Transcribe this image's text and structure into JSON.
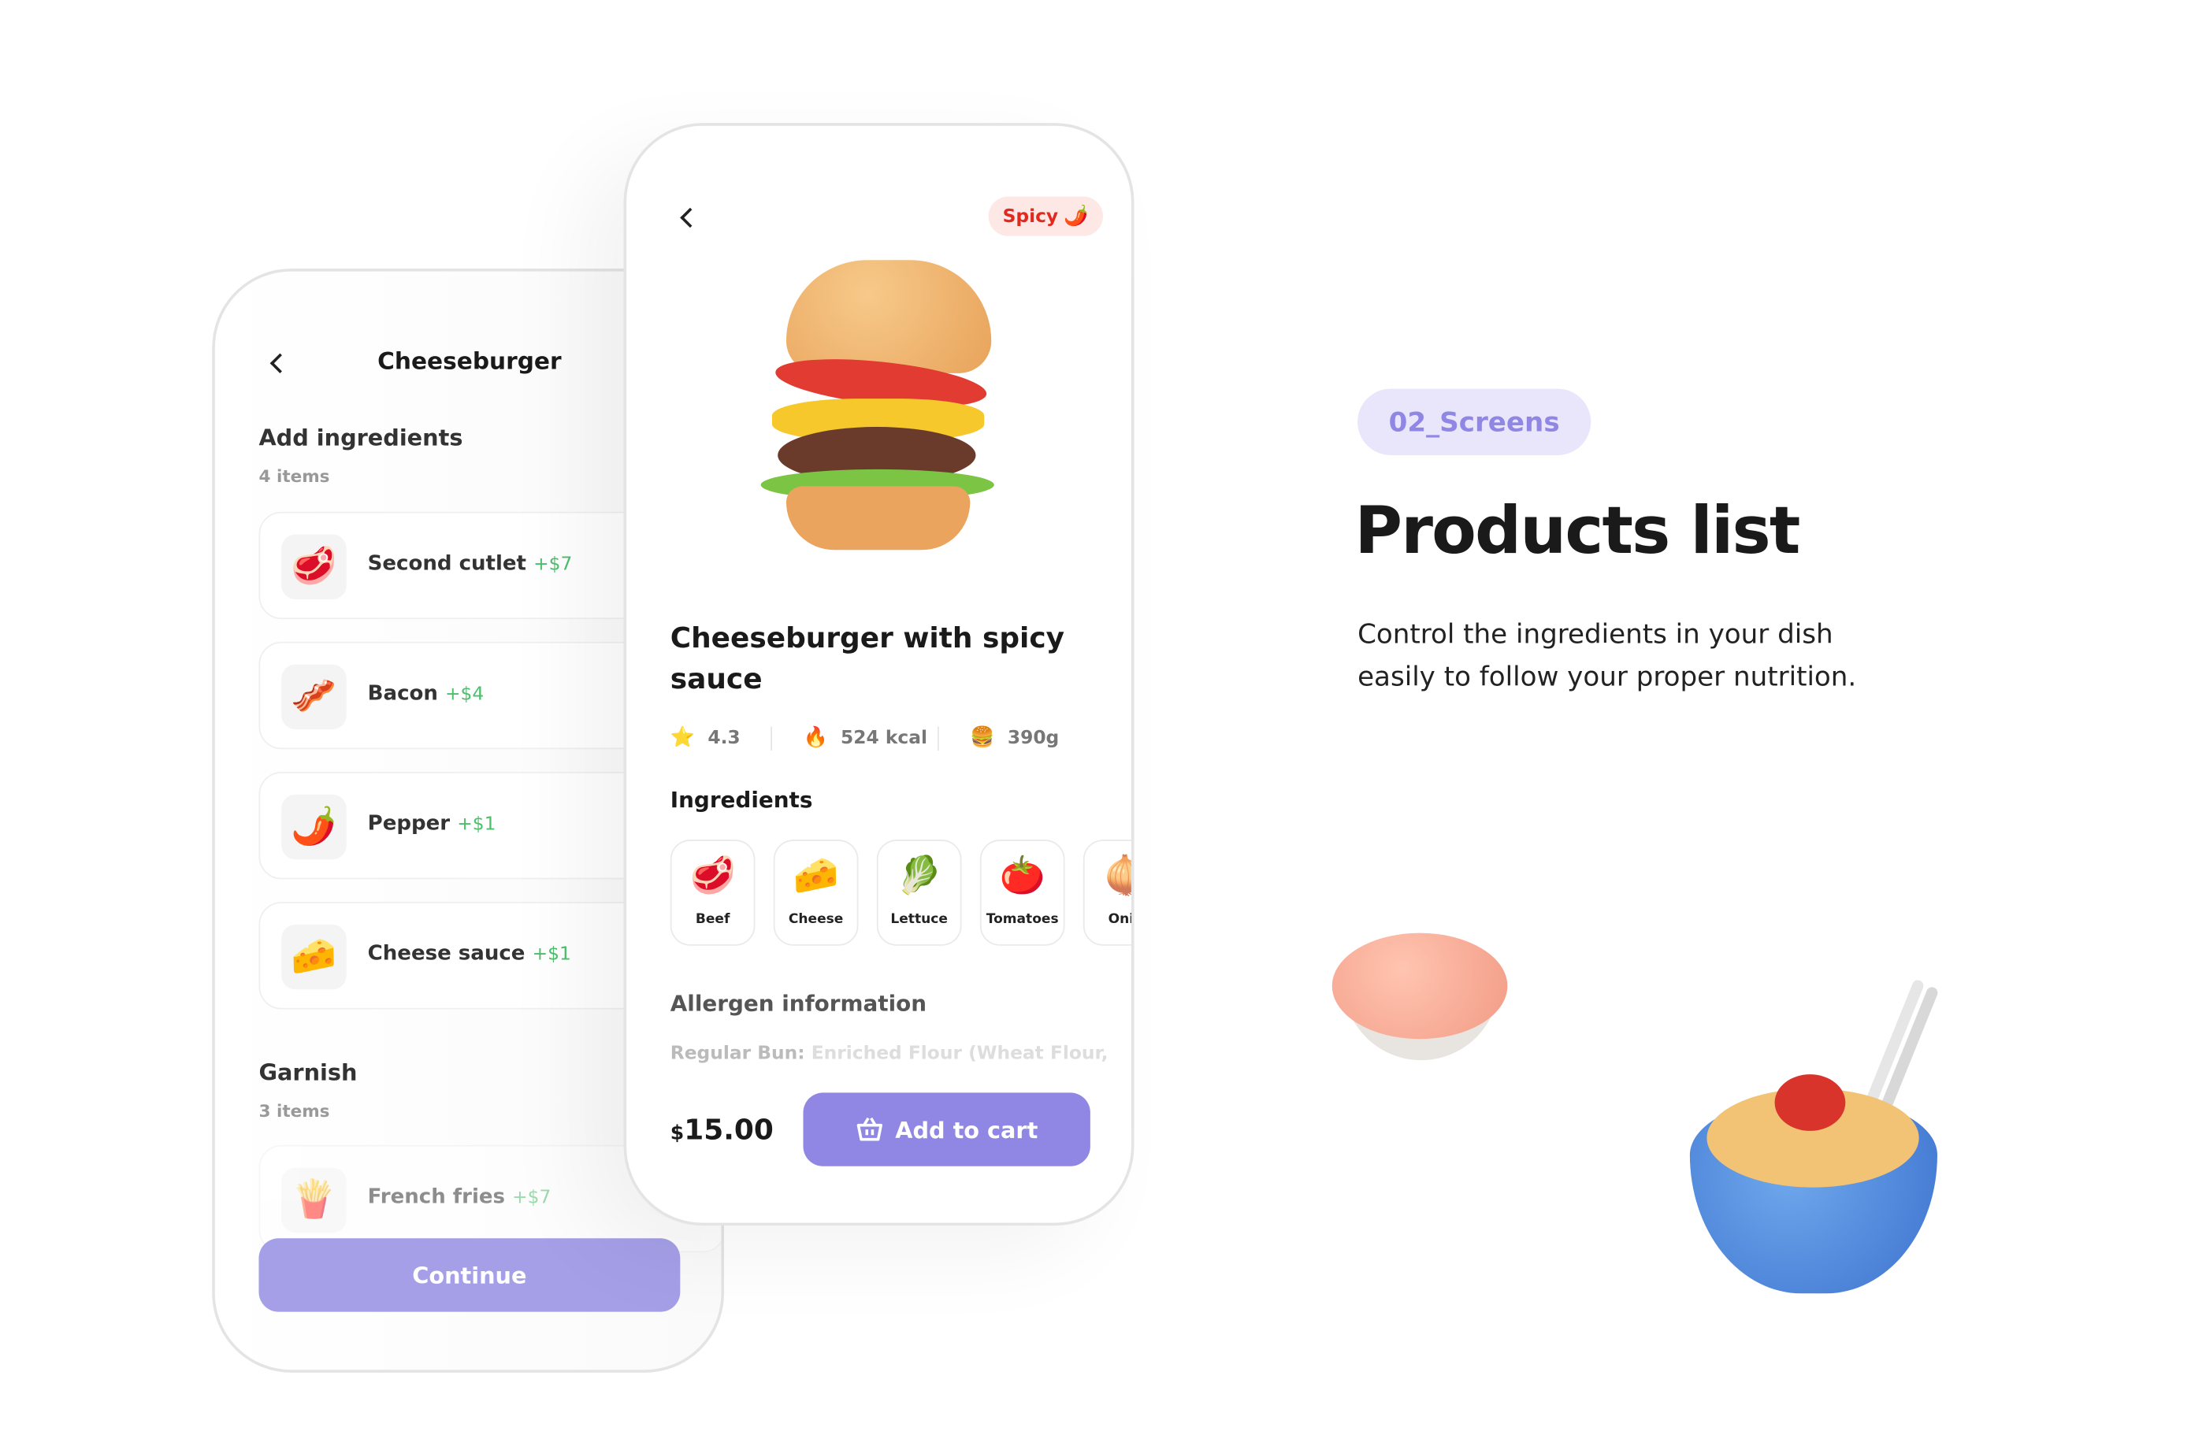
{
  "back_screen": {
    "title": "Cheeseburger",
    "section1": {
      "title": "Add ingredients",
      "count": "4 items"
    },
    "items": [
      {
        "icon": "🥩",
        "name": "Second cutlet",
        "price": "+$7"
      },
      {
        "icon": "🥓",
        "name": "Bacon",
        "price": "+$4"
      },
      {
        "icon": "🌶️",
        "name": "Pepper",
        "price": "+$1"
      },
      {
        "icon": "🧀",
        "name": "Cheese sauce",
        "price": "+$1"
      }
    ],
    "section2": {
      "title": "Garnish",
      "count": "3 items"
    },
    "garnish": [
      {
        "icon": "🍟",
        "name": "French fries",
        "price": "+$7"
      }
    ],
    "continue_label": "Continue"
  },
  "front_screen": {
    "badge": "Spicy",
    "badge_icon": "🌶️",
    "title": "Cheeseburger with spicy sauce",
    "stats": [
      {
        "icon": "⭐",
        "value": "4.3"
      },
      {
        "icon": "🔥",
        "value": "524 kcal"
      },
      {
        "icon": "🍔",
        "value": "390g"
      }
    ],
    "ingredients_title": "Ingredients",
    "ingredients": [
      {
        "icon": "🥩",
        "label": "Beef"
      },
      {
        "icon": "🧀",
        "label": "Cheese"
      },
      {
        "icon": "🥬",
        "label": "Lettuce"
      },
      {
        "icon": "🍅",
        "label": "Tomatoes"
      },
      {
        "icon": "🧅",
        "label": "Onio"
      }
    ],
    "allergen_title": "Allergen information",
    "allergen_label": "Regular Bun:",
    "allergen_text": "Enriched Flour (Wheat Flour,",
    "price": "15.00",
    "currency": "$",
    "add_to_cart": "Add to cart"
  },
  "info": {
    "tag": "02_Screens",
    "title": "Products list",
    "description": "Control the ingredients in your dish easily to follow your proper nutrition."
  },
  "colors": {
    "accent": "#8f87e3",
    "accent_light": "#a59fe8",
    "tag_bg": "#e9e6fb",
    "price_green": "#4cbf6b",
    "spicy_red": "#e02a1f",
    "spicy_bg": "#fde8e6"
  }
}
